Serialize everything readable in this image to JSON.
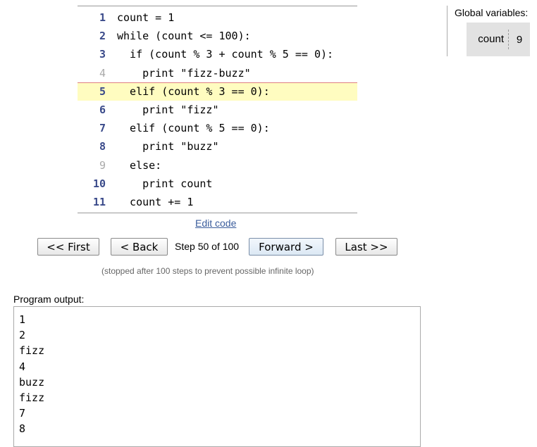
{
  "code": {
    "lines": [
      {
        "num": "1",
        "text": "count = 1"
      },
      {
        "num": "2",
        "text": "while (count <= 100):"
      },
      {
        "num": "3",
        "text": "  if (count % 3 + count % 5 == 0):"
      },
      {
        "num": "4",
        "text": "    print \"fizz-buzz\""
      },
      {
        "num": "5",
        "text": "  elif (count % 3 == 0):"
      },
      {
        "num": "6",
        "text": "    print \"fizz\""
      },
      {
        "num": "7",
        "text": "  elif (count % 5 == 0):"
      },
      {
        "num": "8",
        "text": "    print \"buzz\""
      },
      {
        "num": "9",
        "text": "  else:"
      },
      {
        "num": "10",
        "text": "    print count"
      },
      {
        "num": "11",
        "text": "  count += 1"
      }
    ],
    "current_line": "5"
  },
  "edit_link": "Edit code",
  "nav": {
    "first": "<< First",
    "back": "< Back",
    "step": "Step 50 of 100",
    "forward": "Forward >",
    "last": "Last >>"
  },
  "stopped_note": "(stopped after 100 steps to prevent possible infinite loop)",
  "globals": {
    "title": "Global variables:",
    "vars": [
      {
        "name": "count",
        "value": "9"
      }
    ]
  },
  "output": {
    "label": "Program output:",
    "lines": [
      "1",
      "2",
      "fizz",
      "4",
      "buzz",
      "fizz",
      "7",
      "8"
    ]
  }
}
